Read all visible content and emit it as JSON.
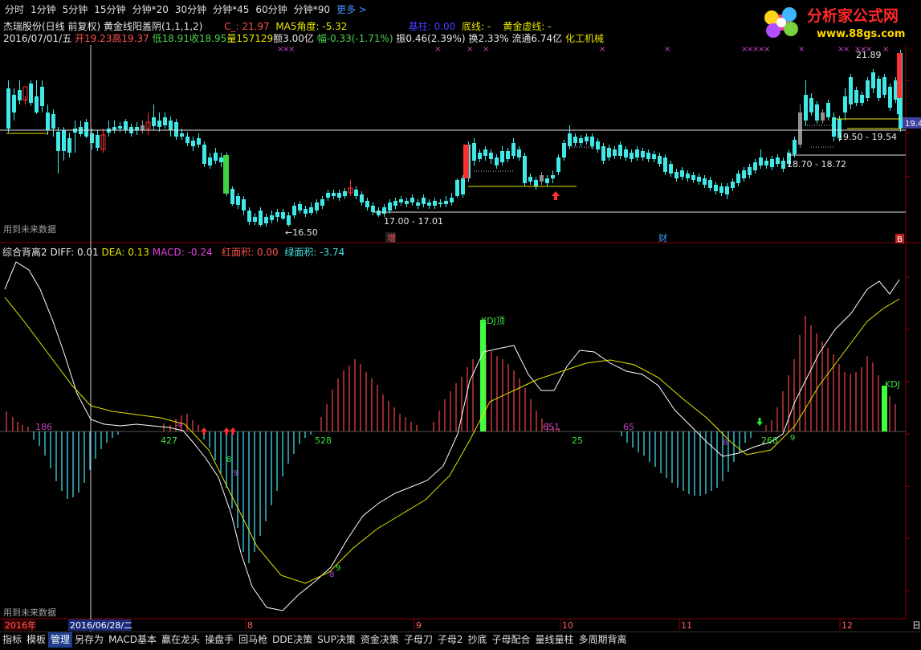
{
  "periods": [
    "分时",
    "1分钟",
    "5分钟",
    "15分钟",
    "分钟*20",
    "30分钟",
    "分钟*45",
    "60分钟",
    "分钟*90"
  ],
  "more_label": "更多 >",
  "logo": {
    "text": "分析家公式网",
    "url": "www.88gs.com"
  },
  "info1": {
    "stock": "杰瑞股份(日线 前复权)",
    "formula": "黄金线阳盖阴(1,1,1,2)",
    "c_label": "C_: 21.97",
    "ma5": "MA5角度: -5.32",
    "base": "基柱: 0.00",
    "bottom": "底线: -",
    "gold": "黄金虚线: -"
  },
  "info2": {
    "date": "2016/07/01/五",
    "open": "开19.23",
    "high": "高19.37",
    "low": "低18.91",
    "close": "收18.95",
    "vol": "量157129",
    "amt": "额3.00亿",
    "chg": "幅-0.33(-1.71%)",
    "amp": "振0.46(2.39%)",
    "turn": "换2.33%",
    "float": "流通6.74亿",
    "sector": "化工机械"
  },
  "price_labels": {
    "l1": "←16.50",
    "l2": "17.00 - 17.01",
    "l3": "18.70 - 18.72",
    "l4": "19.50 - 19.54",
    "l5": "21.89",
    "right": "19.4"
  },
  "future1": "用到未来数据",
  "future2": "用到未来数据",
  "markers": {
    "zeng": "增",
    "cai": "财",
    "b": "B"
  },
  "indicator": {
    "name": "综合背离2",
    "diff": "DIFF: 0.01",
    "dea": "DEA: 0.13",
    "macd": "MACD: -0.24",
    "red": "红面积: 0.00",
    "green": "绿面积: -3.74"
  },
  "ind_labels": {
    "a": "186",
    "b": "427",
    "c": "528",
    "d": "651",
    "e": "25",
    "f": "65",
    "g": "268",
    "kdj1": "KDJ顶",
    "kdj2": "KDJ",
    "n1": "4",
    "n2": "8",
    "n3": "9",
    "n4": "8",
    "n5": "9",
    "n6": "8",
    "n7": "9"
  },
  "date_axis": {
    "year": "2016年",
    "cursor": "2016/06/28/二",
    "m8": "8",
    "m9": "9",
    "m10": "10",
    "m11": "11",
    "m12": "12",
    "right": "日"
  },
  "bottom_buttons": [
    "指标",
    "模板",
    "管理",
    "另存为",
    "MACD基本",
    "赢在龙头",
    "操盘手",
    "回马枪",
    "DDE决策",
    "SUP决策",
    "资金决策",
    "子母刀",
    "子母2",
    "抄底",
    "子母配合",
    "量线量柱",
    "多周期背离"
  ],
  "colors": {
    "up": "#ff3030",
    "down": "#40e8e8",
    "flat": "#909090",
    "green_big": "#40ff40",
    "ma_white": "#ffffff",
    "ma_yellow": "#e6e600"
  },
  "chart_data": [
    {
      "type": "candlestick",
      "title": "杰瑞股份(日线 前复权)",
      "price_levels": [
        16.5,
        17.0,
        17.01,
        18.7,
        18.72,
        19.5,
        19.54,
        21.89
      ],
      "last": {
        "open": 19.23,
        "high": 19.37,
        "low": 18.91,
        "close": 18.95
      }
    },
    {
      "type": "bar",
      "title": "综合背离2",
      "series": [
        {
          "name": "DIFF",
          "values": [
            0.01
          ]
        },
        {
          "name": "DEA",
          "values": [
            0.13
          ]
        },
        {
          "name": "MACD",
          "values": [
            -0.24
          ]
        }
      ],
      "red_area": 0.0,
      "green_area": -3.74
    }
  ]
}
